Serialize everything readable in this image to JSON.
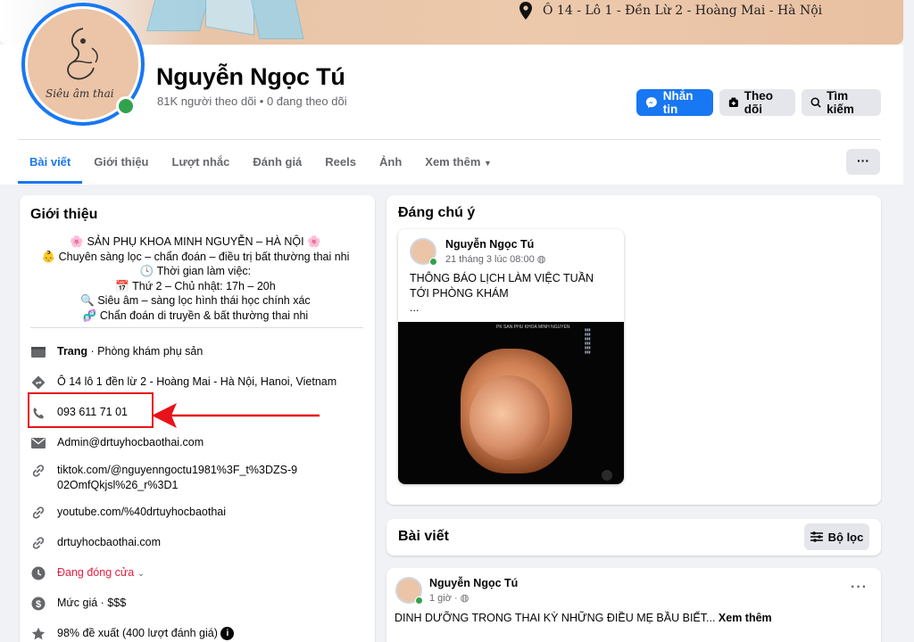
{
  "cover": {
    "address": "Ô 14 - Lô 1 - Đền Lừ 2 - Hoàng Mai - Hà Nội"
  },
  "profile": {
    "avatar_text": "Siêu âm thai",
    "name": "Nguyễn Ngọc Tú",
    "followers": "81K người theo dõi • 0 đang theo dõi"
  },
  "actions": {
    "message": "Nhắn tin",
    "follow": "Theo dõi",
    "search": "Tìm kiếm",
    "more": "···"
  },
  "tabs": [
    "Bài viết",
    "Giới thiệu",
    "Lượt nhắc",
    "Đánh giá",
    "Reels",
    "Ảnh",
    "Xem thêm"
  ],
  "intro": {
    "title": "Giới thiệu",
    "bio": [
      "🌸 SẢN PHỤ KHOA MINH NGUYỄN – HÀ NỘI 🌸",
      "👶 Chuyên sàng lọc – chẩn đoán – điều trị bất thường thai nhi",
      "🕓 Thời gian làm việc:",
      "📅 Thứ 2 – Chủ nhật: 17h – 20h",
      "🔍 Siêu âm – sàng lọc hình thái học chính xác",
      "🧬 Chẩn đoán di truyền & bất thường thai nhi"
    ],
    "page_label": "Trang",
    "page_category": " · Phòng khám phụ sản",
    "address": "Ô 14 lô 1 đền lừ 2 - Hoàng Mai - Hà Nội, Hanoi, Vietnam",
    "phone": "093 611 71 01",
    "email": "Admin@drtuyhocbaothai.com",
    "tiktok": "tiktok.com/@nguyenngoctu1981%3F_t%3DZS-902OmfQkjsl%26_r%3D1",
    "youtube": "youtube.com/%40drtuyhocbaothai",
    "website": "drtuyhocbaothai.com",
    "hours": "Đang đóng cửa",
    "price": "Mức giá · $$$",
    "rating": "98% đề xuất (400 lượt đánh giá)"
  },
  "featured": {
    "title": "Đáng chú ý",
    "author": "Nguyễn Ngọc Tú",
    "time": "21 tháng 3 lúc 08:00",
    "text": "THÔNG BÁO LỊCH LÀM VIỆC TUẦN TỚI PHÒNG KHÁM",
    "ellipsis": "...",
    "image_header": "PK SAN PHU KHOA MINH NGUYEN"
  },
  "posts": {
    "title": "Bài viết",
    "filter": "Bộ lọc",
    "author": "Nguyễn Ngọc Tú",
    "time": "1 giờ",
    "text": "DINH DƯỠNG TRONG THAI KỲ NHỮNG ĐIỀU MẸ BẦU BIẾT...",
    "see_more": "Xem thêm"
  },
  "colors": {
    "accent": "#1877f2",
    "annotation": "#e8131a",
    "online": "#31a24c"
  }
}
